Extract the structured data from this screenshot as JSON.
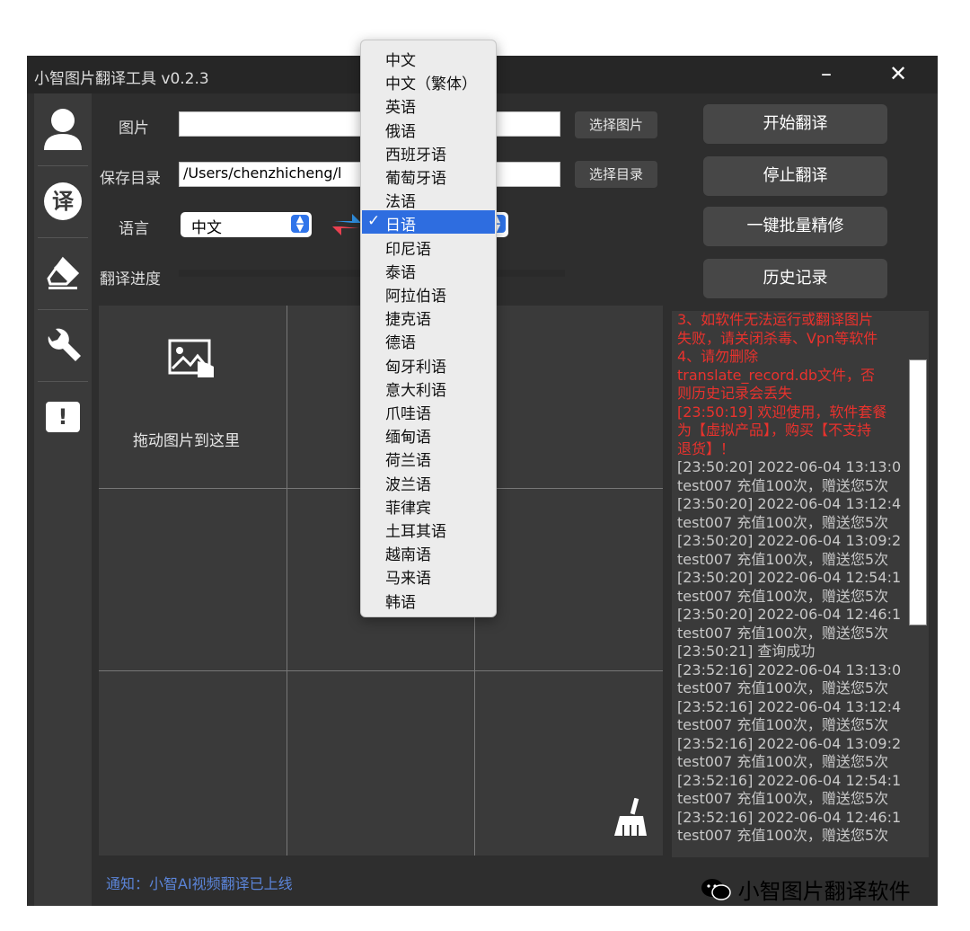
{
  "window": {
    "title": "小智图片翻译工具 v0.2.3",
    "minimize": "–",
    "close": "✕"
  },
  "sidebar": {
    "items": [
      {
        "icon": "user-icon"
      },
      {
        "icon": "translate-icon",
        "glyph": "译"
      },
      {
        "icon": "eraser-icon"
      },
      {
        "icon": "wrench-icon"
      },
      {
        "icon": "feedback-icon",
        "glyph": "!"
      }
    ]
  },
  "form": {
    "image_label": "图片",
    "image_value": "",
    "select_image_button": "选择图片",
    "save_dir_label": "保存目录",
    "save_dir_value": "/Users/chenzhicheng/l",
    "select_dir_button": "选择目录",
    "language_label": "语言",
    "source_language": "中文",
    "progress_label": "翻译进度"
  },
  "actions": {
    "start": "开始翻译",
    "stop": "停止翻译",
    "batch": "一键批量精修",
    "history": "历史记录"
  },
  "drop_zone": {
    "text": "拖动图片到这里"
  },
  "log": [
    {
      "text": "3、如软件无法运行或翻译图片",
      "color": "red"
    },
    {
      "text": "失败，请关闭杀毒、Vpn等软件",
      "color": "red"
    },
    {
      "text": "4、请勿删除",
      "color": "red"
    },
    {
      "text": "translate_record.db文件，否",
      "color": "red"
    },
    {
      "text": "则历史记录会丢失",
      "color": "red"
    },
    {
      "text": "[23:50:19] 欢迎使用，软件套餐",
      "color": "red"
    },
    {
      "text": "为【虚拟产品】，购买【不支持",
      "color": "red"
    },
    {
      "text": "退货】！",
      "color": "red"
    },
    {
      "text": "[23:50:20] 2022-06-04 13:13:0",
      "color": "grey"
    },
    {
      "text": "test007 充值100次，赠送您5次",
      "color": "grey"
    },
    {
      "text": "[23:50:20] 2022-06-04 13:12:4",
      "color": "grey"
    },
    {
      "text": "test007 充值100次，赠送您5次",
      "color": "grey"
    },
    {
      "text": "[23:50:20] 2022-06-04 13:09:2",
      "color": "grey"
    },
    {
      "text": "test007 充值100次，赠送您5次",
      "color": "grey"
    },
    {
      "text": "[23:50:20] 2022-06-04 12:54:1",
      "color": "grey"
    },
    {
      "text": "test007 充值100次，赠送您5次",
      "color": "grey"
    },
    {
      "text": "[23:50:20] 2022-06-04 12:46:1",
      "color": "grey"
    },
    {
      "text": "test007 充值100次，赠送您5次",
      "color": "grey"
    },
    {
      "text": "[23:50:21] 查询成功",
      "color": "grey"
    },
    {
      "text": "[23:52:16] 2022-06-04 13:13:0",
      "color": "grey"
    },
    {
      "text": "test007 充值100次，赠送您5次",
      "color": "grey"
    },
    {
      "text": "[23:52:16] 2022-06-04 13:12:4",
      "color": "grey"
    },
    {
      "text": "test007 充值100次，赠送您5次",
      "color": "grey"
    },
    {
      "text": "[23:52:16] 2022-06-04 13:09:2",
      "color": "grey"
    },
    {
      "text": "test007 充值100次，赠送您5次",
      "color": "grey"
    },
    {
      "text": "[23:52:16] 2022-06-04 12:54:1",
      "color": "grey"
    },
    {
      "text": "test007 充值100次，赠送您5次",
      "color": "grey"
    },
    {
      "text": "[23:52:16] 2022-06-04 12:46:1",
      "color": "grey"
    },
    {
      "text": "test007 充值100次，赠送您5次",
      "color": "grey"
    }
  ],
  "notice": "通知：小智AI视频翻译已上线",
  "watermark": "小智图片翻译软件",
  "language_menu": {
    "selected": "日语",
    "check_mark": "✓",
    "options": [
      "中文",
      "中文（繁体）",
      "英语",
      "俄语",
      "西班牙语",
      "葡萄牙语",
      "法语",
      "日语",
      "印尼语",
      "泰语",
      "阿拉伯语",
      "捷克语",
      "德语",
      "匈牙利语",
      "意大利语",
      "爪哇语",
      "缅甸语",
      "荷兰语",
      "波兰语",
      "菲律宾",
      "土耳其语",
      "越南语",
      "马来语",
      "韩语"
    ]
  },
  "colors": {
    "accent": "#2e6de0",
    "log_red": "#e8322d",
    "notice_blue": "#5b84d8"
  }
}
